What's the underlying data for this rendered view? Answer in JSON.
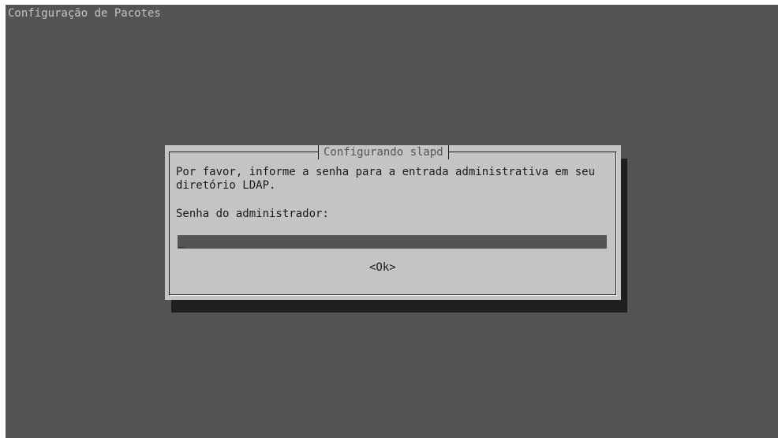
{
  "screen": {
    "title": "Configuração de Pacotes"
  },
  "dialog": {
    "title": "Configurando slapd",
    "message": "Por favor, informe a senha para a entrada administrativa em seu\ndiretório LDAP.",
    "field_label": "Senha do administrador:",
    "password_value": "",
    "ok_label": "<Ok>"
  },
  "colors": {
    "background": "#545455",
    "dialog": "#c4c4c6",
    "shadow": "#1f1f1f",
    "text": "#1a1a1a"
  }
}
